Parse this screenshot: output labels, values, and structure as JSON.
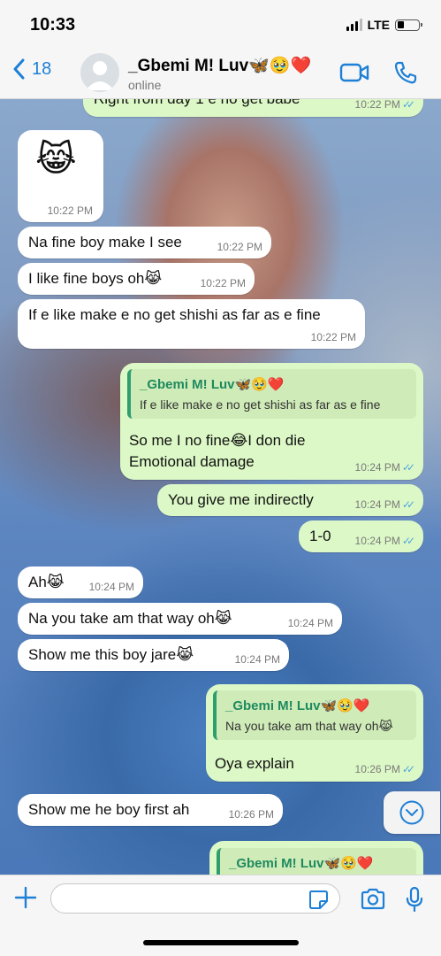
{
  "status_bar": {
    "time": "10:33",
    "network": "LTE"
  },
  "header": {
    "back_count": "18",
    "contact_name": "_Gbemi M! Luv🦋🥹❤️",
    "contact_status": "online"
  },
  "messages": [
    {
      "direction": "out",
      "text": "Right from day 1 e no get babe",
      "time": "10:22 PM"
    },
    {
      "direction": "in",
      "text": "😹",
      "time": "10:22 PM"
    },
    {
      "direction": "in",
      "text": "Na fine boy make I see",
      "time": "10:22 PM"
    },
    {
      "direction": "in",
      "text": "I like fine boys oh😹",
      "time": "10:22 PM"
    },
    {
      "direction": "in",
      "text": "If e like make e no get shishi as far as e fine",
      "time": "10:22 PM"
    },
    {
      "direction": "out",
      "quote_name": "_Gbemi M! Luv🦋🥹❤️",
      "quote_text": "If e like make e no get shishi as far as e fine",
      "text_line1": "So me I no fine😂I don die",
      "text_line2": "Emotional damage",
      "time": "10:24 PM"
    },
    {
      "direction": "out",
      "text": "You give me indirectly",
      "time": "10:24 PM"
    },
    {
      "direction": "out",
      "text": "1-0",
      "time": "10:24 PM"
    },
    {
      "direction": "in",
      "text": "Ah😹",
      "time": "10:24 PM"
    },
    {
      "direction": "in",
      "text": "Na you take am that way oh😹",
      "time": "10:24 PM"
    },
    {
      "direction": "in",
      "text": "Show me this boy jare😹",
      "time": "10:24 PM"
    },
    {
      "direction": "out",
      "quote_name": "_Gbemi M! Luv🦋🥹❤️",
      "quote_text": "Na you take am that way oh😹",
      "text": "Oya explain",
      "time": "10:26 PM"
    },
    {
      "direction": "in",
      "text": "Show me he boy first ah",
      "time": "10:26 PM"
    },
    {
      "direction": "out",
      "quote_name": "_Gbemi M! Luv🦋🥹❤️"
    }
  ],
  "input": {
    "placeholder": ""
  },
  "icons": {
    "back": "chevron-left-icon",
    "video": "video-call-icon",
    "call": "phone-icon",
    "scroll": "chevron-down-circle-icon",
    "plus": "plus-icon",
    "sticker": "sticker-icon",
    "camera": "camera-icon",
    "mic": "microphone-icon"
  },
  "colors": {
    "accent": "#1d7fd6",
    "outgoing_bubble": "#dcf8c6",
    "incoming_bubble": "#ffffff",
    "read_ticks": "#4fa6e0",
    "quote_name": "#1f8a5f"
  }
}
